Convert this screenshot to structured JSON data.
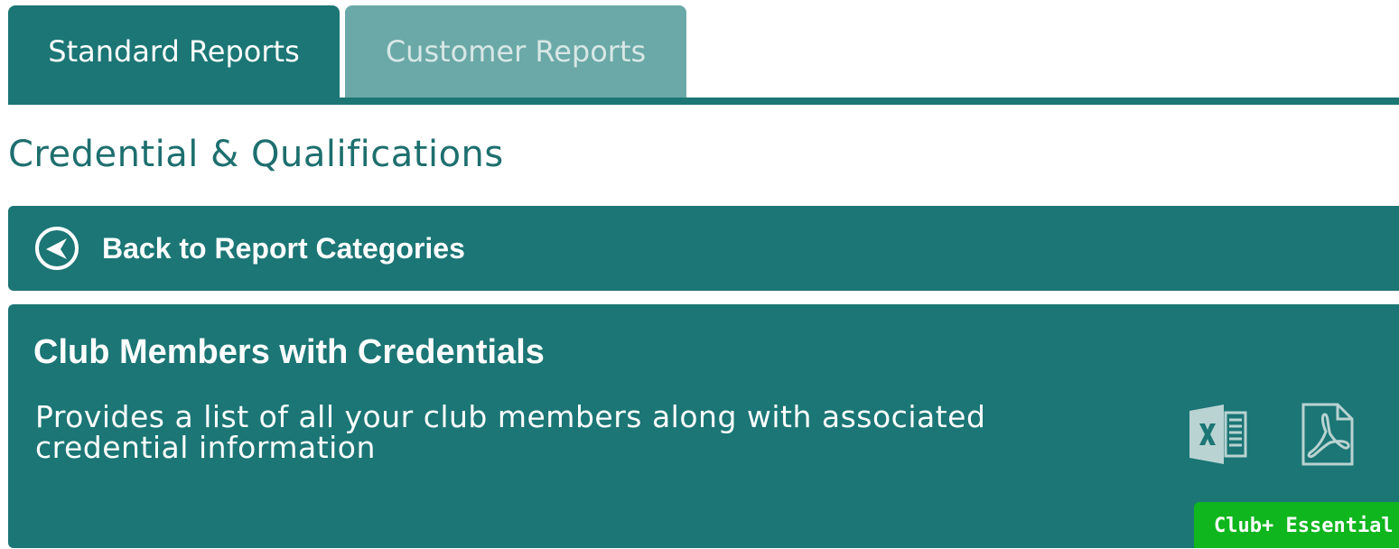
{
  "tabs": [
    {
      "label": "Standard Reports",
      "active": true
    },
    {
      "label": "Customer Reports",
      "active": false
    }
  ],
  "page": {
    "section_title": "Credential & Qualifications"
  },
  "back": {
    "label": "Back to Report Categories",
    "icon": "back-arrow-circle-icon"
  },
  "report": {
    "title": "Club Members with Credentials",
    "description": "Provides a list of all your club members along with associated credential information",
    "actions": [
      {
        "icon": "excel-icon"
      },
      {
        "icon": "pdf-icon"
      }
    ],
    "badge": "Club+ Essential"
  },
  "colors": {
    "primary": "#1b7675",
    "tab_inactive": "#6aa9a7",
    "title": "#1d6f6e",
    "badge": "#0fb61d",
    "text_light": "#ffffff"
  }
}
